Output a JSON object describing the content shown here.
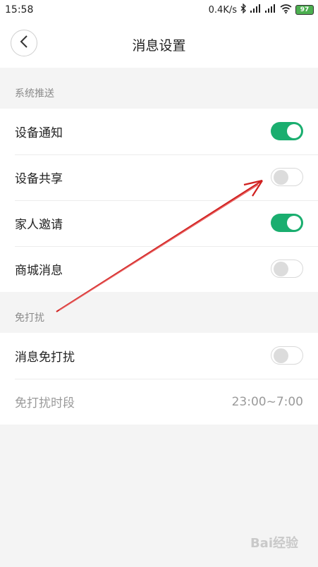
{
  "status_bar": {
    "time": "15:58",
    "network_speed": "0.4K/s",
    "battery": "97",
    "icons": [
      "bluetooth-icon",
      "signal-icon",
      "signal-icon",
      "wifi-icon",
      "battery-icon"
    ]
  },
  "header": {
    "title": "消息设置",
    "back_icon": "chevron-left-icon"
  },
  "sections": {
    "push": {
      "label": "系统推送",
      "items": [
        {
          "label": "设备通知",
          "enabled": true
        },
        {
          "label": "设备共享",
          "enabled": false
        },
        {
          "label": "家人邀请",
          "enabled": true
        },
        {
          "label": "商城消息",
          "enabled": false
        }
      ]
    },
    "dnd": {
      "label": "免打扰",
      "toggle_label": "消息免打扰",
      "toggle_enabled": false,
      "period_label": "免打扰时段",
      "period_value": "23:00~7:00"
    }
  },
  "colors": {
    "toggle_on": "#1aae6f",
    "annotation_arrow": "#d0201f"
  },
  "watermark": "Bai经验"
}
